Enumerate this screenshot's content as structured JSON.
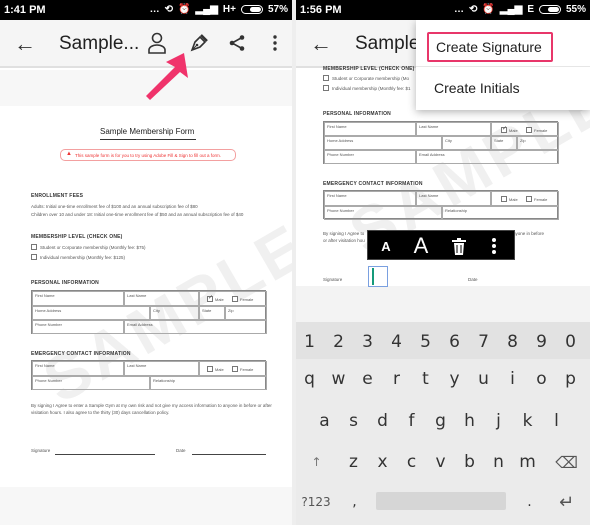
{
  "left_screen": {
    "status": {
      "time": "1:41 PM",
      "network": "H+",
      "battery": "57%",
      "battery_level": 0.57
    },
    "appbar": {
      "title": "Sample...",
      "icons": [
        "back-arrow-icon",
        "person-icon",
        "pen-icon",
        "share-icon",
        "more-vertical-icon"
      ]
    },
    "annotation": "arrow pointing to pen icon",
    "document": {
      "title": "Sample Membership Form",
      "notice": "This sample form is for you to try using Adobe Fill & Sign to fill out a form.",
      "watermark": "SAMPLE",
      "enrollment": {
        "heading": "ENROLLMENT FEES",
        "lines": [
          "Adults: Initial one-time enrollment fee of $100 and an annual subscription fee of $80",
          "Children over 10 and under 18: Initial one-time enrollment fee of $50 and an annual subscription fee of $40"
        ]
      },
      "membership": {
        "heading": "MEMBERSHIP LEVEL (CHECK ONE)",
        "options": [
          "Student or Corporate membership (Monthly fee: $75)",
          "Individual membership (Monthly fee: $125)"
        ]
      },
      "personal": {
        "heading": "PERSONAL INFORMATION",
        "fields": {
          "first_name": "First Name",
          "last_name": "Last Name",
          "male": "Male",
          "female": "Female",
          "home_address": "Home Address",
          "city": "City",
          "state": "State",
          "zip": "Zip",
          "phone": "Phone Number",
          "email": "Email Address"
        },
        "male_checked": true
      },
      "emergency": {
        "heading": "EMERGENCY CONTACT INFORMATION",
        "fields": {
          "first_name": "First Name",
          "last_name": "Last Name",
          "male": "Male",
          "female": "Female",
          "phone": "Phone Number",
          "relationship": "Relationship"
        }
      },
      "agreement": "By signing I Agree to enter a Sample Gym at my own risk and not give my access information to anyone in before or after visitation hours. I also agree to the thirty (30) days cancellation policy.",
      "signature_label": "Signature",
      "date_label": "Date"
    }
  },
  "right_screen": {
    "status": {
      "time": "1:56 PM",
      "network": "E",
      "battery": "55%",
      "battery_level": 0.55
    },
    "appbar": {
      "title": "Sample..."
    },
    "menu": {
      "items": [
        "Create Signature",
        "Create Initials"
      ],
      "highlighted": "Create Signature"
    },
    "document": {
      "membership": {
        "heading": "MEMBERSHIP LEVEL (CHECK ONE)",
        "options": [
          "Student or Corporate membership (Mo",
          "Individual membership (Monthly fee: $1"
        ]
      },
      "personal": {
        "heading": "PERSONAL INFORMATION",
        "fields": {
          "first_name": "First Name",
          "last_name": "Last Name",
          "male": "Male",
          "female": "Female",
          "home_address": "Home Address",
          "city": "City",
          "state": "State",
          "zip": "Zip",
          "phone": "Phone Number",
          "email": "Email Address"
        }
      },
      "emergency": {
        "heading": "EMERGENCY CONTACT INFORMATION",
        "fields": {
          "first_name": "First Name",
          "last_name": "Last Name",
          "male": "Male",
          "female": "Female",
          "phone": "Phone Number",
          "relationship": "Relationship"
        }
      },
      "agreement_left": "By signing I Agree to",
      "agreement_left2": "or after visitation hou",
      "agreement_right": "tion to anyone in before",
      "signature_label": "Signature",
      "date_label": "Date"
    },
    "text_toolbar": {
      "small_a": "A",
      "large_a": "A",
      "icons": [
        "decrease-font-icon",
        "increase-font-icon",
        "trash-icon",
        "more-vertical-icon"
      ]
    },
    "keyboard": {
      "numbers": [
        "1",
        "2",
        "3",
        "4",
        "5",
        "6",
        "7",
        "8",
        "9",
        "0"
      ],
      "row1": [
        "q",
        "w",
        "e",
        "r",
        "t",
        "y",
        "u",
        "i",
        "o",
        "p"
      ],
      "row2": [
        "a",
        "s",
        "d",
        "f",
        "g",
        "h",
        "j",
        "k",
        "l"
      ],
      "row3": [
        "z",
        "x",
        "c",
        "v",
        "b",
        "n",
        "m"
      ],
      "symbols_key": "?123",
      "comma": ",",
      "period": ".",
      "shift_icon": "↑",
      "backspace_icon": "⌫",
      "enter_icon": "↵"
    }
  }
}
